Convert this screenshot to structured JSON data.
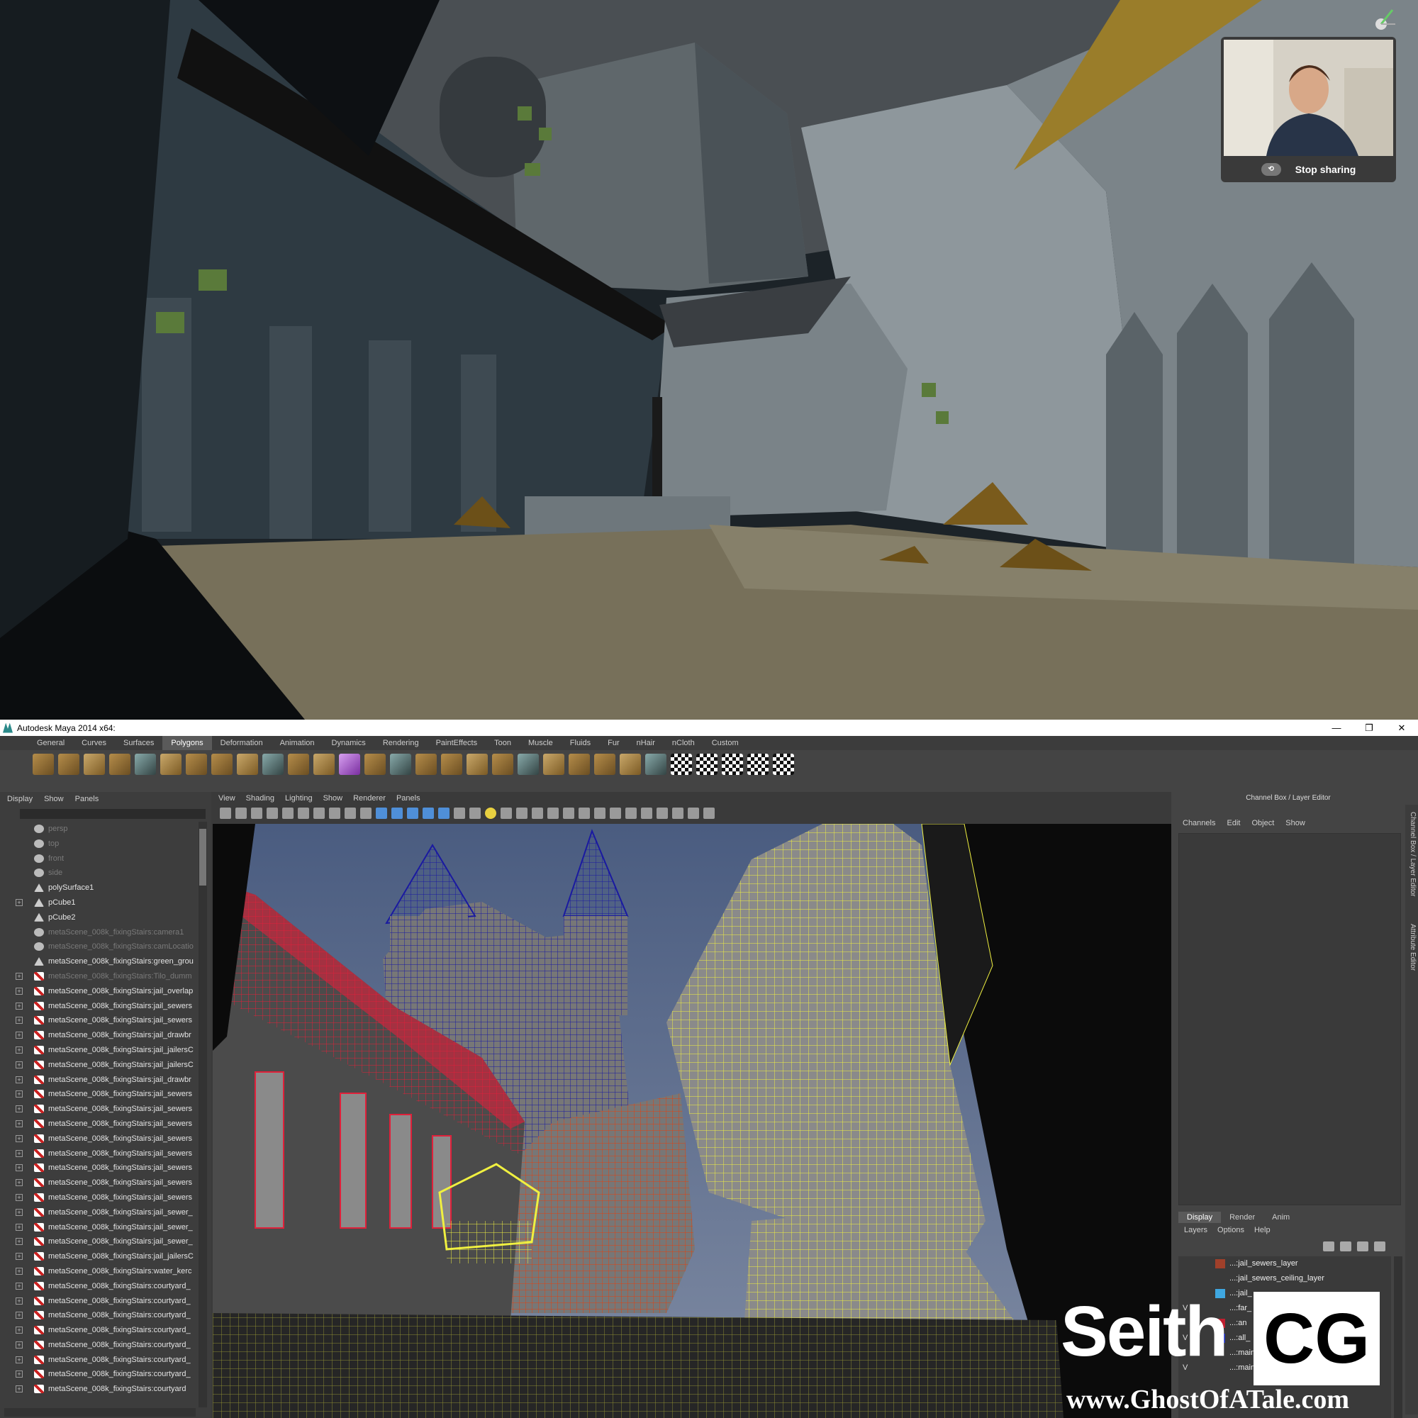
{
  "share_overlay": {
    "stop_label": "Stop sharing"
  },
  "maya": {
    "window_title": "Autodesk Maya 2014 x64:",
    "window_controls": [
      "—",
      "❐",
      "✕"
    ],
    "shelf_tabs": [
      "General",
      "Curves",
      "Surfaces",
      "Polygons",
      "Deformation",
      "Animation",
      "Dynamics",
      "Rendering",
      "PaintEffects",
      "Toon",
      "Muscle",
      "Fluids",
      "Fur",
      "nHair",
      "nCloth",
      "Custom"
    ],
    "shelf_active_tab": "Polygons",
    "outliner": {
      "menu": [
        "Display",
        "Show",
        "Panels"
      ],
      "items": [
        {
          "label": "persp",
          "dim": true,
          "icon": "camera-icon",
          "expand": false
        },
        {
          "label": "top",
          "dim": true,
          "icon": "camera-icon",
          "expand": false
        },
        {
          "label": "front",
          "dim": true,
          "icon": "camera-icon",
          "expand": false
        },
        {
          "label": "side",
          "dim": true,
          "icon": "camera-icon",
          "expand": false
        },
        {
          "label": "polySurface1",
          "dim": false,
          "icon": "poly-icon",
          "expand": false
        },
        {
          "label": "pCube1",
          "dim": false,
          "icon": "poly-icon",
          "expand": true
        },
        {
          "label": "pCube2",
          "dim": false,
          "icon": "poly-icon",
          "expand": false
        },
        {
          "label": "metaScene_008k_fixingStairs:camera1",
          "dim": true,
          "icon": "camera-icon",
          "expand": false
        },
        {
          "label": "metaScene_008k_fixingStairs:camLocatio",
          "dim": true,
          "icon": "camera-icon",
          "expand": false
        },
        {
          "label": "metaScene_008k_fixingStairs:green_grou",
          "dim": false,
          "icon": "poly-icon",
          "expand": false
        },
        {
          "label": "metaScene_008k_fixingStairs:Tilo_dumm",
          "dim": true,
          "icon": "mesh-icon",
          "expand": true
        },
        {
          "label": "metaScene_008k_fixingStairs:jail_overlap",
          "dim": false,
          "icon": "mesh-icon",
          "expand": true
        },
        {
          "label": "metaScene_008k_fixingStairs:jail_sewers",
          "dim": false,
          "icon": "mesh-icon",
          "expand": true
        },
        {
          "label": "metaScene_008k_fixingStairs:jail_sewers",
          "dim": false,
          "icon": "mesh-icon",
          "expand": true
        },
        {
          "label": "metaScene_008k_fixingStairs:jail_drawbr",
          "dim": false,
          "icon": "mesh-icon",
          "expand": true
        },
        {
          "label": "metaScene_008k_fixingStairs:jail_jailersC",
          "dim": false,
          "icon": "mesh-icon",
          "expand": true
        },
        {
          "label": "metaScene_008k_fixingStairs:jail_jailersC",
          "dim": false,
          "icon": "mesh-icon",
          "expand": true
        },
        {
          "label": "metaScene_008k_fixingStairs:jail_drawbr",
          "dim": false,
          "icon": "mesh-icon",
          "expand": true
        },
        {
          "label": "metaScene_008k_fixingStairs:jail_sewers",
          "dim": false,
          "icon": "mesh-icon",
          "expand": true
        },
        {
          "label": "metaScene_008k_fixingStairs:jail_sewers",
          "dim": false,
          "icon": "mesh-icon",
          "expand": true
        },
        {
          "label": "metaScene_008k_fixingStairs:jail_sewers",
          "dim": false,
          "icon": "mesh-icon",
          "expand": true
        },
        {
          "label": "metaScene_008k_fixingStairs:jail_sewers",
          "dim": false,
          "icon": "mesh-icon",
          "expand": true
        },
        {
          "label": "metaScene_008k_fixingStairs:jail_sewers",
          "dim": false,
          "icon": "mesh-icon",
          "expand": true
        },
        {
          "label": "metaScene_008k_fixingStairs:jail_sewers",
          "dim": false,
          "icon": "mesh-icon",
          "expand": true
        },
        {
          "label": "metaScene_008k_fixingStairs:jail_sewers",
          "dim": false,
          "icon": "mesh-icon",
          "expand": true
        },
        {
          "label": "metaScene_008k_fixingStairs:jail_sewers",
          "dim": false,
          "icon": "mesh-icon",
          "expand": true
        },
        {
          "label": "metaScene_008k_fixingStairs:jail_sewer_",
          "dim": false,
          "icon": "mesh-icon",
          "expand": true
        },
        {
          "label": "metaScene_008k_fixingStairs:jail_sewer_",
          "dim": false,
          "icon": "mesh-icon",
          "expand": true
        },
        {
          "label": "metaScene_008k_fixingStairs:jail_sewer_",
          "dim": false,
          "icon": "mesh-icon",
          "expand": true
        },
        {
          "label": "metaScene_008k_fixingStairs:jail_jailersC",
          "dim": false,
          "icon": "mesh-icon",
          "expand": true
        },
        {
          "label": "metaScene_008k_fixingStairs:water_kerc",
          "dim": false,
          "icon": "mesh-icon",
          "expand": true
        },
        {
          "label": "metaScene_008k_fixingStairs:courtyard_",
          "dim": false,
          "icon": "mesh-icon",
          "expand": true
        },
        {
          "label": "metaScene_008k_fixingStairs:courtyard_",
          "dim": false,
          "icon": "mesh-icon",
          "expand": true
        },
        {
          "label": "metaScene_008k_fixingStairs:courtyard_",
          "dim": false,
          "icon": "mesh-icon",
          "expand": true
        },
        {
          "label": "metaScene_008k_fixingStairs:courtyard_",
          "dim": false,
          "icon": "mesh-icon",
          "expand": true
        },
        {
          "label": "metaScene_008k_fixingStairs:courtyard_",
          "dim": false,
          "icon": "mesh-icon",
          "expand": true
        },
        {
          "label": "metaScene_008k_fixingStairs:courtyard_",
          "dim": false,
          "icon": "mesh-icon",
          "expand": true
        },
        {
          "label": "metaScene_008k_fixingStairs:courtyard_",
          "dim": false,
          "icon": "mesh-icon",
          "expand": true
        },
        {
          "label": "metaScene_008k_fixingStairs:courtyard",
          "dim": false,
          "icon": "mesh-icon",
          "expand": true
        }
      ]
    },
    "viewport": {
      "menu": [
        "View",
        "Shading",
        "Lighting",
        "Show",
        "Renderer",
        "Panels"
      ]
    },
    "channel_box": {
      "title": "Channel Box / Layer Editor",
      "menu": [
        "Channels",
        "Edit",
        "Object",
        "Show"
      ],
      "side_tabs": [
        "Channel Box / Layer Editor",
        "Attribute Editor"
      ],
      "layer_tabs": [
        "Display",
        "Render",
        "Anim"
      ],
      "layer_active_tab": "Display",
      "layer_menu": [
        "Layers",
        "Options",
        "Help"
      ],
      "layers": [
        {
          "v": "",
          "color": "#a0402a",
          "name": "...:jail_sewers_layer"
        },
        {
          "v": "",
          "color": "#3a3a3a",
          "name": "...:jail_sewers_ceiling_layer"
        },
        {
          "v": "",
          "color": "#3fa7e0",
          "name": "...:jail_"
        },
        {
          "v": "V",
          "color": "#3a3a3a",
          "name": "...:far_"
        },
        {
          "v": "",
          "color": "#c02030",
          "name": "...:an"
        },
        {
          "v": "V",
          "color": "#2030c0",
          "name": "...:all_"
        },
        {
          "v": "",
          "color": "#3a3a3a",
          "name": "...:main"
        },
        {
          "v": "V",
          "color": "#3a3a3a",
          "name": "...:main"
        }
      ]
    }
  },
  "watermark": {
    "brand_left": "Seith",
    "brand_right": "CG",
    "url": "www.GhostOfATale.com"
  },
  "colors": {
    "wire_red": "#e0203a",
    "wire_blue": "#1a1aa0",
    "wire_orange": "#e04010",
    "wire_yellow": "#f0f040",
    "ground_sand": "#77705a"
  }
}
